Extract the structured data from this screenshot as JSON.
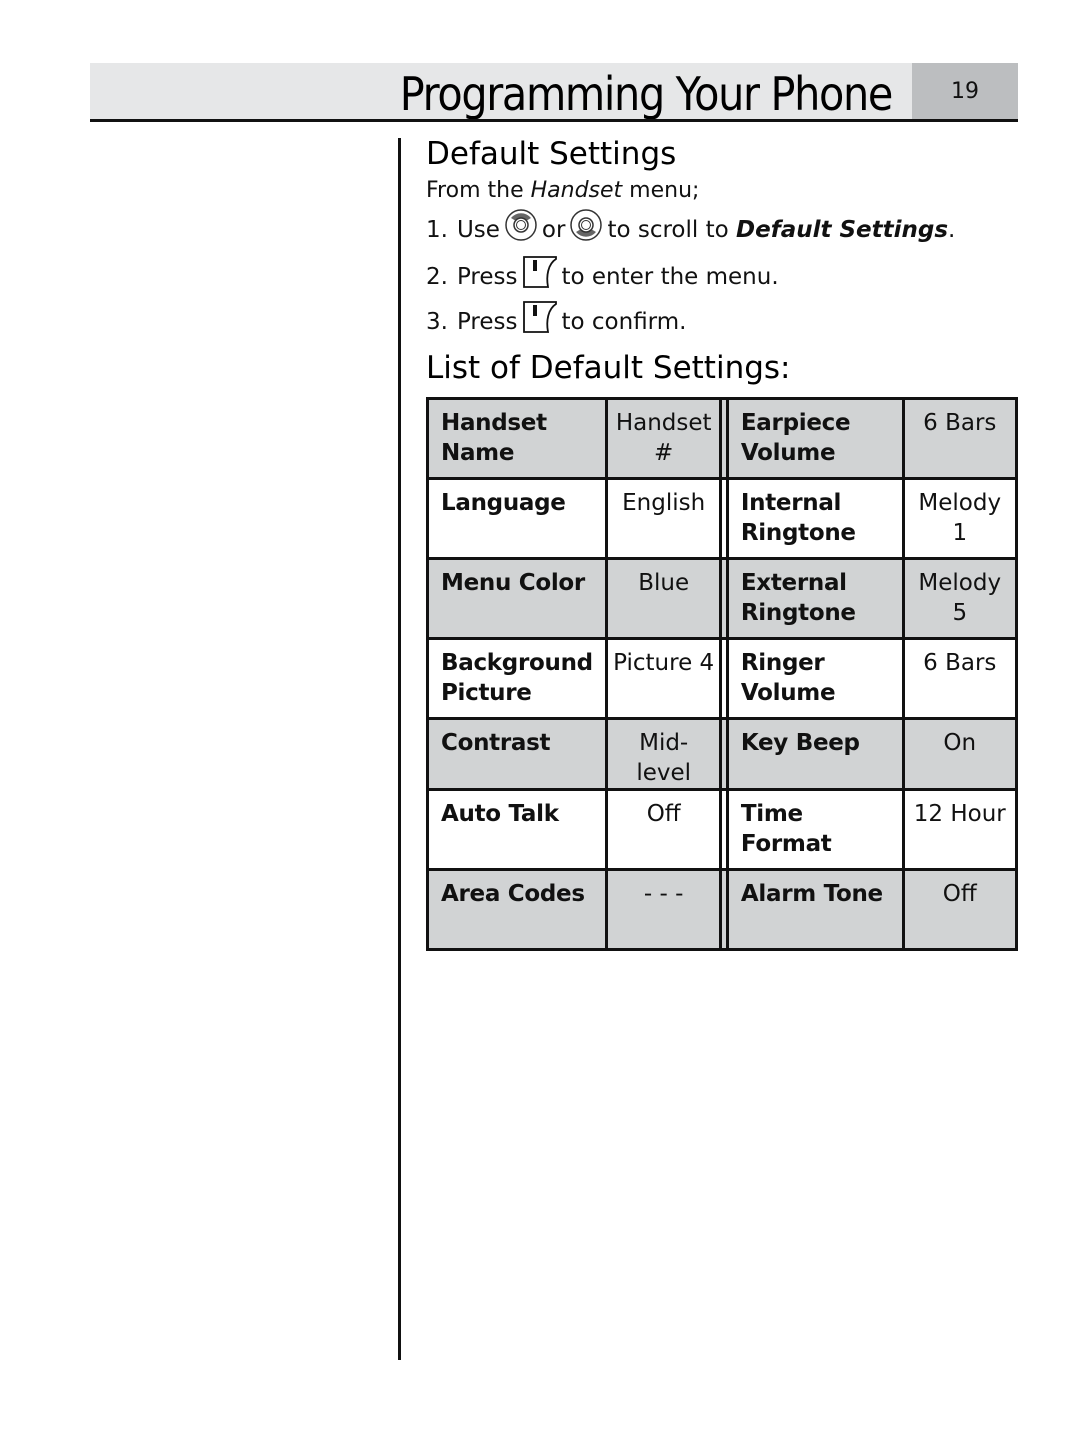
{
  "header": {
    "title": "Programming Your Phone",
    "page_number": "19"
  },
  "section": {
    "title": "Default Settings",
    "from_prefix": "From the ",
    "from_menu": "Handset",
    "from_suffix": " menu;",
    "steps": [
      {
        "number": "1.",
        "parts": [
          "Use",
          "or",
          "to scroll to",
          "Default Settings",
          "."
        ],
        "icons": [
          "nav-up-key-icon",
          "nav-down-key-icon"
        ]
      },
      {
        "number": "2.",
        "parts": [
          "Press",
          "to enter the menu."
        ],
        "icons": [
          "left-softkey-icon"
        ]
      },
      {
        "number": "3.",
        "parts": [
          "Press",
          "to confirm."
        ],
        "icons": [
          "left-softkey-icon"
        ]
      }
    ]
  },
  "defaults_list": {
    "title": "List of Default Settings:",
    "rows": [
      {
        "shade": true,
        "left_label": "Handset Name",
        "left_value": "Handset #",
        "right_label": "Earpiece Volume",
        "right_value": "6 Bars"
      },
      {
        "shade": false,
        "left_label": "Language",
        "left_value": "English",
        "right_label": "Internal Ringtone",
        "right_value": "Melody 1"
      },
      {
        "shade": true,
        "left_label": "Menu Color",
        "left_value": "Blue",
        "right_label": "External Ringtone",
        "right_value": "Melody 5"
      },
      {
        "shade": false,
        "left_label": "Background Picture",
        "left_value": "Picture 4",
        "right_label": "Ringer Volume",
        "right_value": "6 Bars"
      },
      {
        "shade": true,
        "left_label": "Contrast",
        "left_value": "Mid-level",
        "right_label": "Key Beep",
        "right_value": "On"
      },
      {
        "shade": false,
        "left_label": "Auto Talk",
        "left_value": "Off",
        "right_label": "Time Format",
        "right_value": "12 Hour"
      },
      {
        "shade": true,
        "left_label": "Area Codes",
        "left_value": "- - -",
        "right_label": "Alarm Tone",
        "right_value": "Off"
      }
    ]
  },
  "colors": {
    "header_band": "#e6e7e8",
    "page_number_box": "#bcbec0",
    "row_shade": "#d1d3d4",
    "rule": "#111111"
  }
}
